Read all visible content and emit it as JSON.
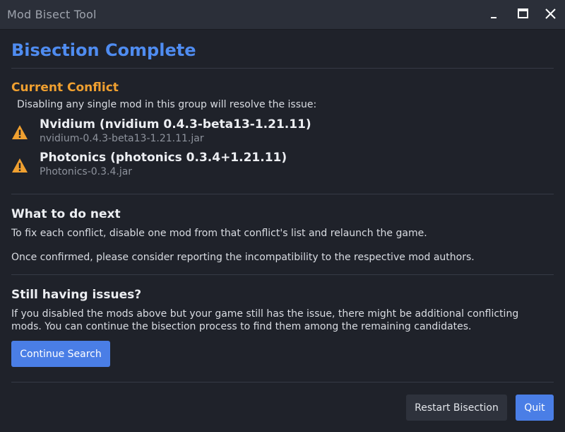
{
  "window": {
    "title": "Mod Bisect Tool"
  },
  "header": {
    "title": "Bisection Complete"
  },
  "conflict": {
    "heading": "Current Conflict",
    "description": "Disabling any single mod in this group will resolve the issue:",
    "mods": [
      {
        "name": "Nvidium (nvidium 0.4.3-beta13-1.21.11)",
        "file": "nvidium-0.4.3-beta13-1.21.11.jar",
        "icon": "warning-icon"
      },
      {
        "name": "Photonics (photonics 0.3.4+1.21.11)",
        "file": "Photonics-0.3.4.jar",
        "icon": "warning-icon"
      }
    ]
  },
  "next_steps": {
    "heading": "What to do next",
    "line1": "To fix each conflict, disable one mod from that conflict's list and relaunch the game.",
    "line2": "Once confirmed, please consider reporting the incompatibility to the respective mod authors."
  },
  "issues": {
    "heading": "Still having issues?",
    "text": "If you disabled the mods above but your game still has the issue, there might be additional conflicting mods. You can continue the bisection process to find them among the remaining candidates.",
    "continue_label": "Continue Search"
  },
  "footer": {
    "restart_label": "Restart Bisection",
    "quit_label": "Quit"
  },
  "colors": {
    "accent_blue": "#4f8cf0",
    "button_blue": "#4a7ee6",
    "warning_orange": "#f0a030",
    "background": "#1f222a",
    "titlebar": "#2b2f39"
  }
}
